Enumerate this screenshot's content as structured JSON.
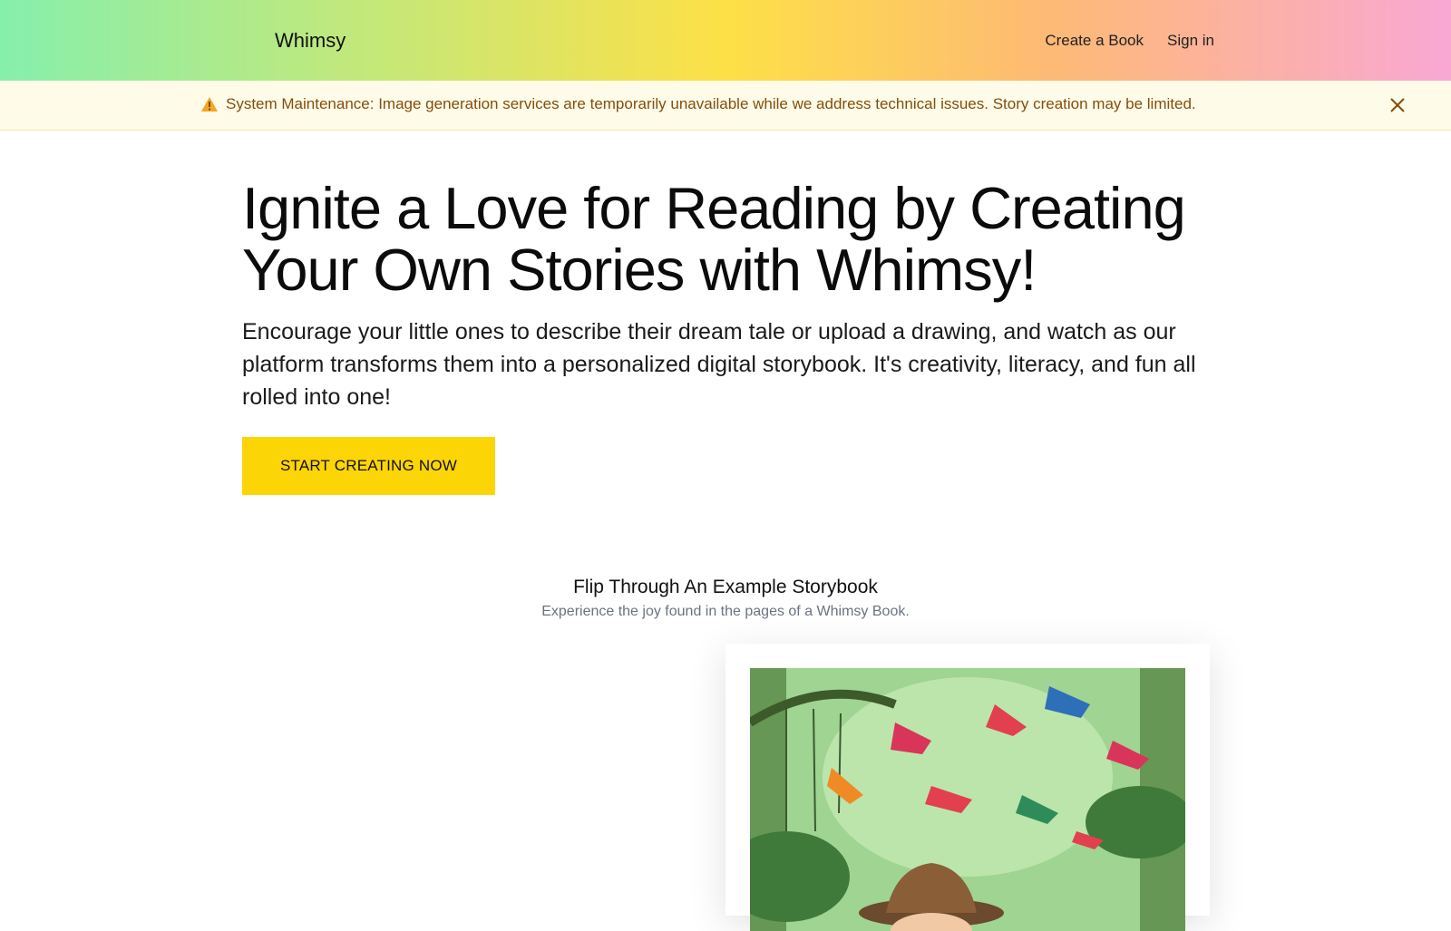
{
  "header": {
    "brand": "Whimsy",
    "nav": [
      {
        "label": "Create a Book"
      },
      {
        "label": "Sign in"
      }
    ]
  },
  "banner": {
    "icon": "warning-icon",
    "message": "System Maintenance: Image generation services are temporarily unavailable while we address technical issues. Story creation may be limited.",
    "close_icon": "close-icon"
  },
  "hero": {
    "title": "Ignite a Love for Reading by Creating Your Own Stories with Whimsy!",
    "description": "Encourage your little ones to describe their dream tale or upload a drawing, and watch as our platform transforms them into a personalized digital storybook. It's creativity, literacy, and fun all rolled into one!",
    "cta_label": "START CREATING NOW"
  },
  "example": {
    "title": "Flip Through An Example Storybook",
    "subtitle": "Experience the joy found in the pages of a Whimsy Book."
  },
  "colors": {
    "cta": "#fcd507",
    "banner_bg": "#fefce8",
    "banner_text": "#854d0e",
    "gradient": [
      "#86efac",
      "#fde047",
      "#f9a8d4"
    ]
  }
}
